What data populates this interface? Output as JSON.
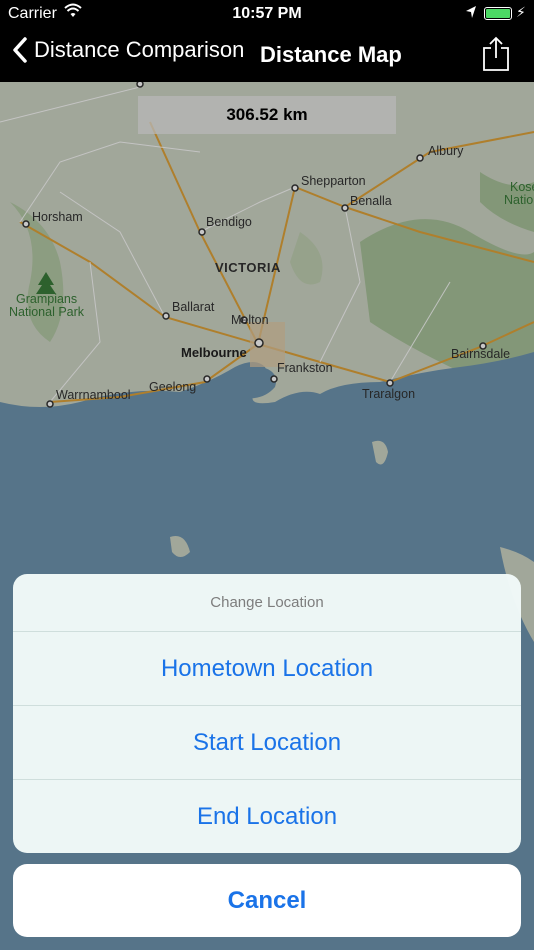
{
  "status_bar": {
    "carrier": "Carrier",
    "time": "10:57 PM"
  },
  "nav": {
    "back_label": "Distance Comparison",
    "title": "Distance Map"
  },
  "map": {
    "distance": "306.52 km",
    "labels": {
      "horsham": "Horsham",
      "bendigo": "Bendigo",
      "shepparton": "Shepparton",
      "benalla": "Benalla",
      "albury": "Albury",
      "kose": "Kose",
      "natio": "Natio",
      "victoria": "VICTORIA",
      "grampians_1": "Grampians",
      "grampians_2": "National Park",
      "ballarat": "Ballarat",
      "melton": "Melton",
      "melbourne": "Melbourne",
      "frankston": "Frankston",
      "geelong": "Geelong",
      "warrnambool": "Warrnambool",
      "traralgon": "Traralgon",
      "bairnsdale": "Bairnsdale"
    }
  },
  "action_sheet": {
    "title": "Change Location",
    "options": [
      "Hometown Location",
      "Start Location",
      "End Location"
    ],
    "cancel": "Cancel"
  },
  "colors": {
    "accent": "#1a73e8",
    "water": "#6f95b0",
    "land": "#cfd6c6",
    "road": "#e0a339"
  }
}
